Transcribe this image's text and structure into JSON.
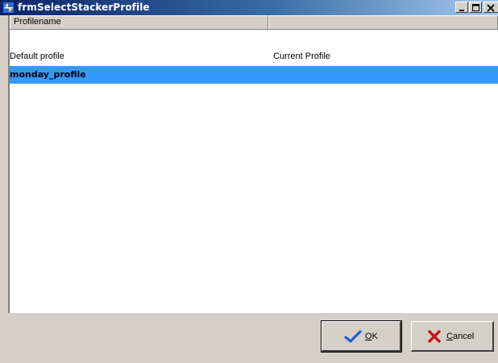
{
  "window": {
    "title": "frmSelectStackerProfile"
  },
  "titlebar_buttons": {
    "minimize": "minimize-icon",
    "maximize": "maximize-icon",
    "close": "close-icon"
  },
  "list": {
    "columns": [
      "Profilename",
      ""
    ],
    "rows": [
      {
        "name": "Default profile",
        "status": "Current Profile",
        "selected": false
      },
      {
        "name": "monday_profile",
        "status": "",
        "selected": true
      }
    ]
  },
  "buttons": {
    "ok": {
      "mnemonic": "O",
      "rest": "K",
      "icon": "checkmark-icon"
    },
    "cancel": {
      "mnemonic": "C",
      "rest": "ancel",
      "icon": "x-mark-icon"
    }
  },
  "colors": {
    "title_start": "#0a246a",
    "title_end": "#a6caf0",
    "selection": "#3399ff",
    "ok_check": "#1f5fd6",
    "cancel_x": "#c81414"
  }
}
